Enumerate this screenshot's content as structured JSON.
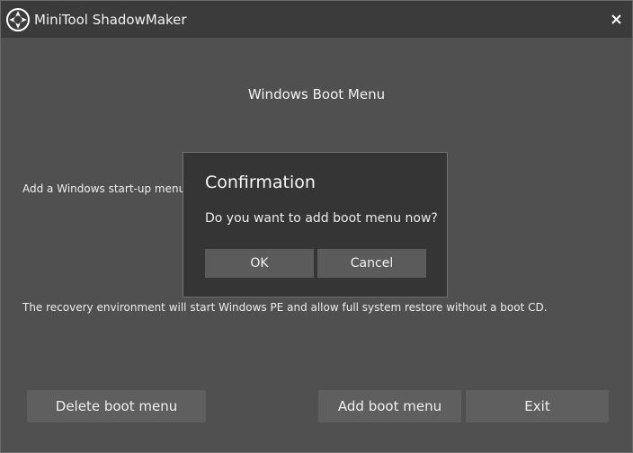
{
  "window": {
    "title": "MiniTool ShadowMaker",
    "close_icon": "close-icon"
  },
  "main": {
    "heading": "Windows Boot Menu",
    "description_1": "Add a Windows start-up menu op",
    "description_2": "The recovery environment will start Windows PE and allow full system restore without a boot CD."
  },
  "actions": {
    "delete_label": "Delete boot menu",
    "add_label": "Add boot menu",
    "exit_label": "Exit"
  },
  "dialog": {
    "title": "Confirmation",
    "message": "Do you want to add boot menu now?",
    "ok_label": "OK",
    "cancel_label": "Cancel"
  },
  "colors": {
    "window_bg": "#505050",
    "titlebar_bg": "#3b3b3b",
    "dialog_bg": "#353535",
    "button_bg": "#5f5f5f"
  }
}
